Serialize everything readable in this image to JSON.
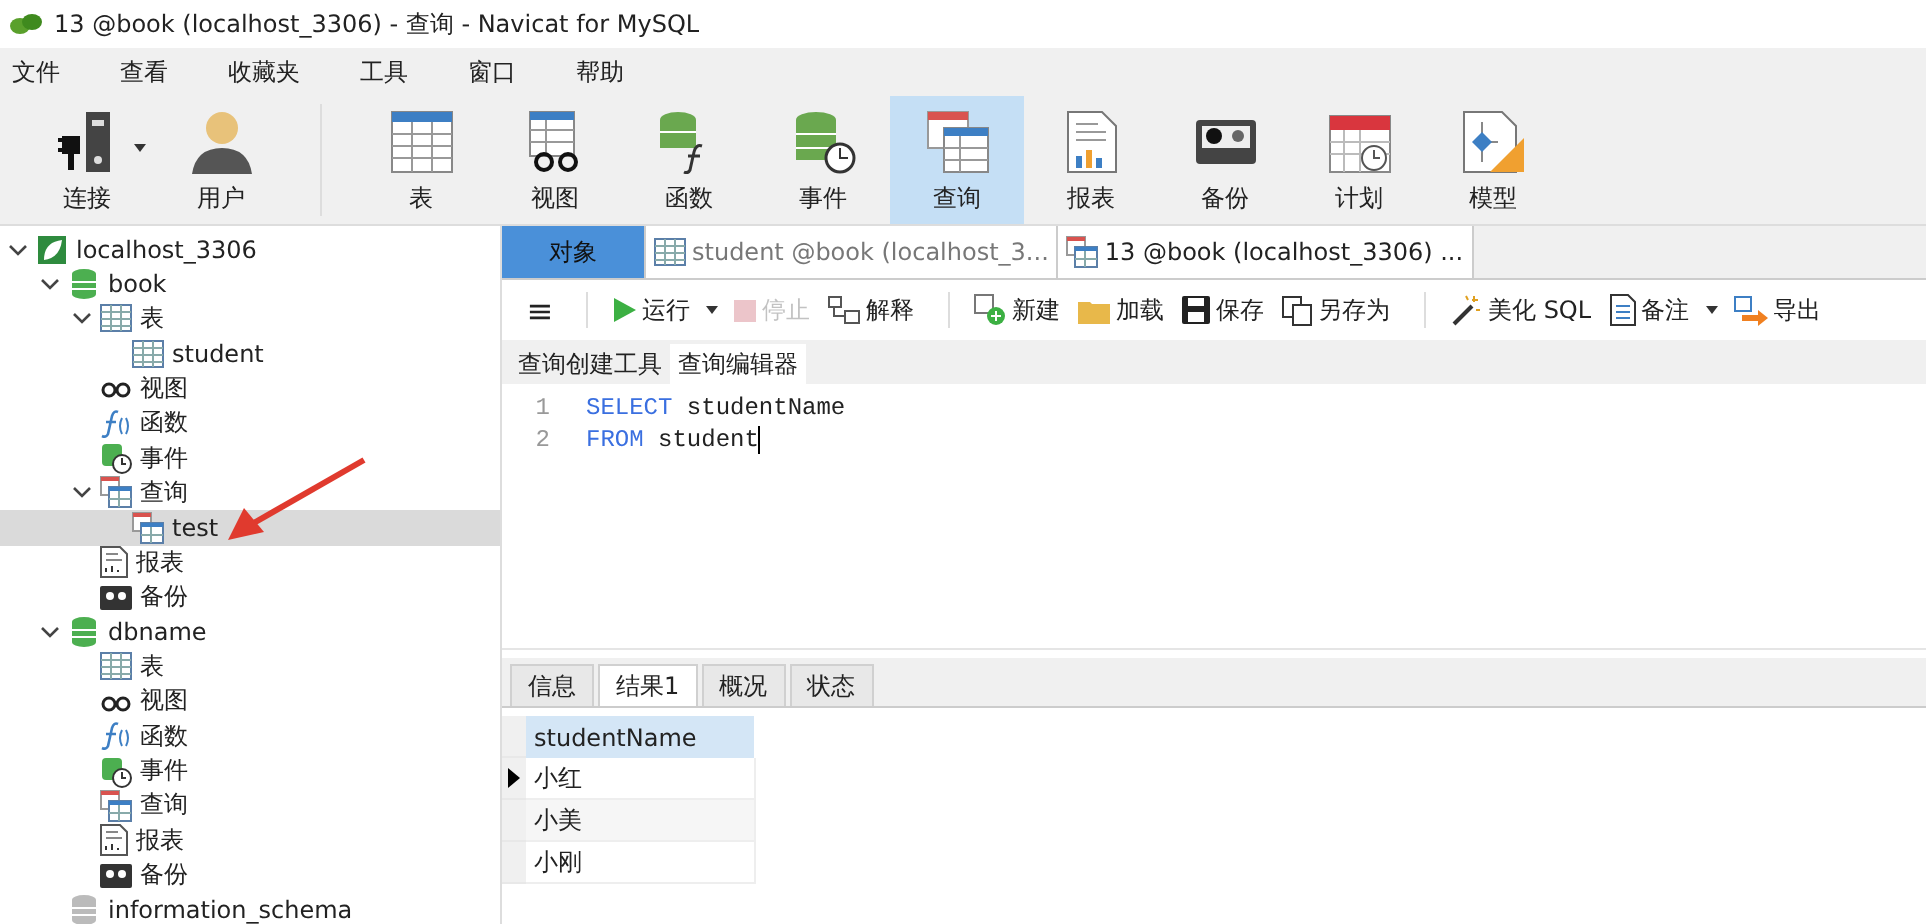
{
  "window": {
    "title": "13 @book (localhost_3306) - 查询 - Navicat for MySQL"
  },
  "menu": [
    "文件",
    "查看",
    "收藏夹",
    "工具",
    "窗口",
    "帮助"
  ],
  "toolbar": [
    {
      "label": "连接",
      "kind": "connect",
      "selected": false,
      "dropdown": true,
      "group_end": false
    },
    {
      "label": "用户",
      "kind": "user",
      "selected": false,
      "dropdown": false,
      "group_end": true
    },
    {
      "label": "表",
      "kind": "table",
      "selected": false,
      "dropdown": false,
      "group_end": false
    },
    {
      "label": "视图",
      "kind": "view",
      "selected": false,
      "dropdown": false,
      "group_end": false
    },
    {
      "label": "函数",
      "kind": "function",
      "selected": false,
      "dropdown": false,
      "group_end": false
    },
    {
      "label": "事件",
      "kind": "event",
      "selected": false,
      "dropdown": false,
      "group_end": false
    },
    {
      "label": "查询",
      "kind": "query",
      "selected": true,
      "dropdown": false,
      "group_end": false
    },
    {
      "label": "报表",
      "kind": "report",
      "selected": false,
      "dropdown": false,
      "group_end": false
    },
    {
      "label": "备份",
      "kind": "backup",
      "selected": false,
      "dropdown": false,
      "group_end": false
    },
    {
      "label": "计划",
      "kind": "schedule",
      "selected": false,
      "dropdown": false,
      "group_end": false
    },
    {
      "label": "模型",
      "kind": "model",
      "selected": false,
      "dropdown": false,
      "group_end": false
    }
  ],
  "tree": [
    {
      "label": "localhost_3306",
      "kind": "connection",
      "expanded": true,
      "selected": false,
      "children": [
        {
          "label": "book",
          "kind": "database",
          "expanded": true,
          "selected": false,
          "children": [
            {
              "label": "表",
              "kind": "tables",
              "expanded": true,
              "selected": false,
              "children": [
                {
                  "label": "student",
                  "kind": "table",
                  "selected": false
                }
              ]
            },
            {
              "label": "视图",
              "kind": "views",
              "selected": false
            },
            {
              "label": "函数",
              "kind": "functions",
              "selected": false
            },
            {
              "label": "事件",
              "kind": "events",
              "selected": false
            },
            {
              "label": "查询",
              "kind": "queries",
              "expanded": true,
              "selected": false,
              "children": [
                {
                  "label": "test",
                  "kind": "query",
                  "selected": true
                }
              ]
            },
            {
              "label": "报表",
              "kind": "reports",
              "selected": false
            },
            {
              "label": "备份",
              "kind": "backups",
              "selected": false
            }
          ]
        },
        {
          "label": "dbname",
          "kind": "database",
          "expanded": true,
          "selected": false,
          "children": [
            {
              "label": "表",
              "kind": "tables",
              "selected": false
            },
            {
              "label": "视图",
              "kind": "views",
              "selected": false
            },
            {
              "label": "函数",
              "kind": "functions",
              "selected": false
            },
            {
              "label": "事件",
              "kind": "events",
              "selected": false
            },
            {
              "label": "查询",
              "kind": "queries",
              "selected": false
            },
            {
              "label": "报表",
              "kind": "reports",
              "selected": false
            },
            {
              "label": "备份",
              "kind": "backups",
              "selected": false
            }
          ]
        },
        {
          "label": "information_schema",
          "kind": "database_closed",
          "selected": false
        }
      ]
    }
  ],
  "doc_tabs": [
    {
      "label": "对象",
      "kind": "objects",
      "selected": false
    },
    {
      "label": "student @book (localhost_3...",
      "kind": "table",
      "selected": false
    },
    {
      "label": "13 @book (localhost_3306) ...",
      "kind": "query",
      "selected": true
    }
  ],
  "menu_button": {
    "label": "≡"
  },
  "query_toolbar": [
    {
      "kind": "run",
      "label": "运行",
      "disabled": false,
      "dropdown": true
    },
    {
      "kind": "stop",
      "label": "停止",
      "disabled": true,
      "dropdown": false
    },
    {
      "kind": "explain",
      "label": "解释",
      "disabled": false,
      "dropdown": false
    },
    {
      "kind": "new",
      "label": "新建",
      "disabled": false,
      "dropdown": false
    },
    {
      "kind": "load",
      "label": "加载",
      "disabled": false,
      "dropdown": false
    },
    {
      "kind": "save",
      "label": "保存",
      "disabled": false,
      "dropdown": false
    },
    {
      "kind": "saveas",
      "label": "另存为",
      "disabled": false,
      "dropdown": false
    },
    {
      "kind": "beautify",
      "label": "美化 SQL",
      "disabled": false,
      "dropdown": false
    },
    {
      "kind": "note",
      "label": "备注",
      "disabled": false,
      "dropdown": true
    },
    {
      "kind": "export",
      "label": "导出",
      "disabled": false,
      "dropdown": false
    }
  ],
  "editor_tabs": [
    {
      "label": "查询创建工具",
      "selected": false
    },
    {
      "label": "查询编辑器",
      "selected": true
    }
  ],
  "code_lines": [
    {
      "number": "1",
      "keyword": "SELECT",
      "text": " studentName",
      "cursor": false
    },
    {
      "number": "2",
      "keyword": "FROM",
      "text": " student",
      "cursor": true
    }
  ],
  "result_tabs": [
    {
      "label": "信息",
      "selected": false
    },
    {
      "label": "结果1",
      "selected": true
    },
    {
      "label": "概况",
      "selected": false
    },
    {
      "label": "状态",
      "selected": false
    }
  ],
  "result_grid": {
    "columns": [
      "studentName"
    ],
    "rows": [
      {
        "cells": [
          "小红"
        ],
        "current": true
      },
      {
        "cells": [
          "小美"
        ],
        "current": false
      },
      {
        "cells": [
          "小刚"
        ],
        "current": false
      }
    ]
  },
  "annotation": {
    "kind": "arrow"
  }
}
